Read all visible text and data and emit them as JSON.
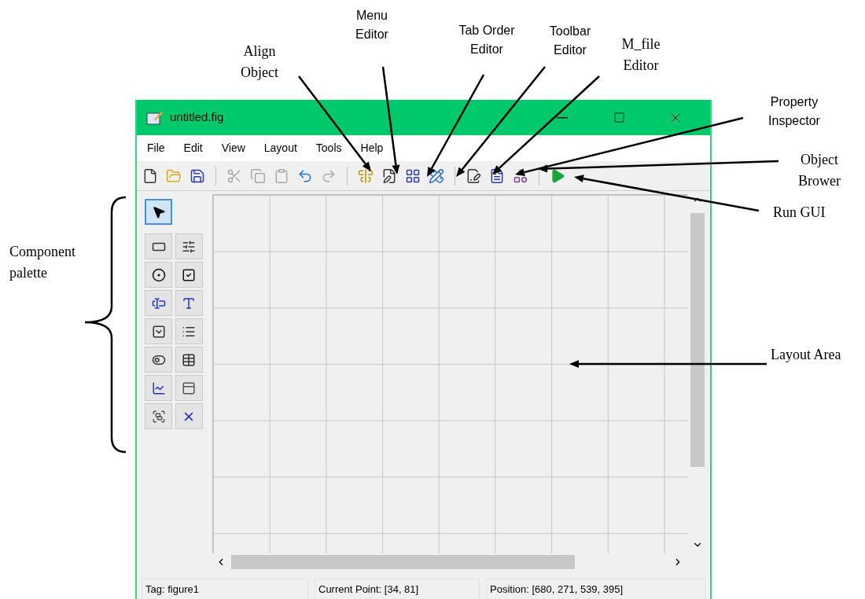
{
  "annotations": [
    "Align\nObject",
    "Menu\nEditor",
    "Tab Order\nEditor",
    "Toolbar\nEditor",
    "M_file\nEditor",
    "Property\nInspector",
    "Object\nBrower",
    "Run GUI",
    "Layout Area",
    "Component\npalette"
  ],
  "window": {
    "title": "untitled.fig"
  },
  "menu": [
    "File",
    "Edit",
    "View",
    "Layout",
    "Tools",
    "Help"
  ],
  "toolbar": [
    {
      "kind": "new",
      "disabled": false
    },
    {
      "kind": "open",
      "disabled": false
    },
    {
      "kind": "save",
      "disabled": false
    },
    {
      "kind": "sep"
    },
    {
      "kind": "cut",
      "disabled": true
    },
    {
      "kind": "copy",
      "disabled": true
    },
    {
      "kind": "paste",
      "disabled": true
    },
    {
      "kind": "undo",
      "disabled": false
    },
    {
      "kind": "redo",
      "disabled": true
    },
    {
      "kind": "sep"
    },
    {
      "kind": "align",
      "disabled": false
    },
    {
      "kind": "menu",
      "disabled": false
    },
    {
      "kind": "taborder",
      "disabled": false
    },
    {
      "kind": "toolbar",
      "disabled": false
    },
    {
      "kind": "sep"
    },
    {
      "kind": "mfile",
      "disabled": false
    },
    {
      "kind": "inspector",
      "disabled": false
    },
    {
      "kind": "browser",
      "disabled": false
    },
    {
      "kind": "sep"
    },
    {
      "kind": "run",
      "disabled": false
    }
  ],
  "palette": [
    {
      "kind": "pointer",
      "selected": true
    },
    {
      "kind": "push",
      "selected": false
    },
    {
      "kind": "slider",
      "selected": false
    },
    {
      "kind": "radio",
      "selected": false
    },
    {
      "kind": "check",
      "selected": false
    },
    {
      "kind": "edit",
      "selected": false
    },
    {
      "kind": "text",
      "selected": false
    },
    {
      "kind": "popup",
      "selected": false
    },
    {
      "kind": "listbox",
      "selected": false
    },
    {
      "kind": "toggle",
      "selected": false
    },
    {
      "kind": "table",
      "selected": false
    },
    {
      "kind": "axes",
      "selected": false
    },
    {
      "kind": "panel",
      "selected": false
    },
    {
      "kind": "group",
      "selected": false
    },
    {
      "kind": "activex",
      "selected": false
    }
  ],
  "status_bar": [
    "Tag: figure1",
    "Current Point:  [34, 81]",
    "Position: [680, 271, 539, 395]"
  ]
}
